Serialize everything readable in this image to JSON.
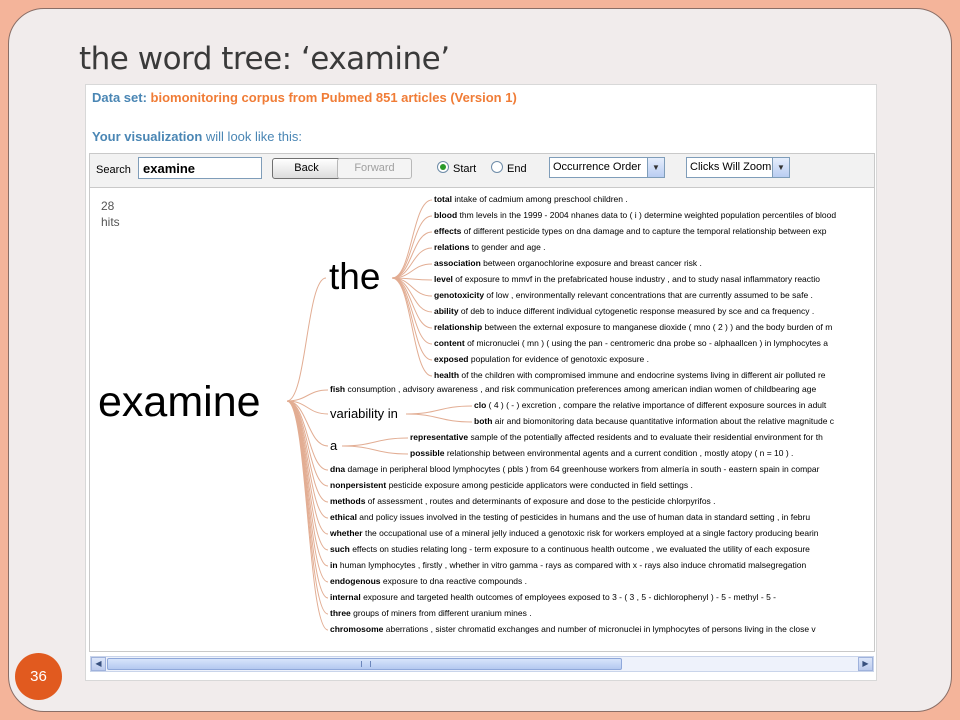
{
  "slide": {
    "title": "the word tree: ‘examine’",
    "page_number": "36"
  },
  "dataset": {
    "label": "Data set:",
    "value": "biomonitoring corpus from Pubmed 851 articles (Version 1)"
  },
  "visualization": {
    "bold": "Your visualization",
    "rest": " will look like this:"
  },
  "toolbar": {
    "search_label": "Search",
    "search_value": "examine",
    "back_label": "Back",
    "forward_label": "Forward",
    "start_label": "Start",
    "end_label": "End",
    "order_value": "Occurrence Order",
    "zoom_value": "Clicks Will Zoom"
  },
  "tree": {
    "hits_count": "28",
    "hits_label": "hits",
    "root": "examine",
    "the_node": "the",
    "variability_node": "variability in",
    "a_node": "a",
    "the_children": [
      {
        "w": "total",
        "t": " intake of cadmium among preschool children ."
      },
      {
        "w": "blood",
        "t": " thm levels in the 1999 - 2004 nhanes data to ( i ) determine weighted population percentiles of blood"
      },
      {
        "w": "effects",
        "t": " of different pesticide types on dna damage and to capture the temporal relationship between exp"
      },
      {
        "w": "relations",
        "t": " to gender and age ."
      },
      {
        "w": "association",
        "t": " between organochlorine exposure and breast cancer risk ."
      },
      {
        "w": "level",
        "t": " of exposure to mmvf in the prefabricated house industry , and to study nasal inflammatory reactio"
      },
      {
        "w": "genotoxicity",
        "t": " of low , environmentally relevant concentrations that are currently assumed to be safe ."
      },
      {
        "w": "ability",
        "t": " of deb to induce different individual cytogenetic response measured by sce and ca frequency ."
      },
      {
        "w": "relationship",
        "t": " between the external exposure to manganese dioxide ( mno ( 2 ) ) and the body burden of m"
      },
      {
        "w": "content",
        "t": " of micronuclei ( mn ) ( using the pan - centromeric dna probe so - alphaallcen ) in lymphocytes a"
      },
      {
        "w": "exposed",
        "t": " population for evidence of genotoxic exposure ."
      },
      {
        "w": "health",
        "t": " of the children with compromised immune and endocrine systems living in different air polluted re"
      }
    ],
    "fish": {
      "w": "fish",
      "t": " consumption , advisory awareness , and risk communication preferences among american indian women of childbearing age"
    },
    "variability_children": [
      {
        "w": "clo",
        "t": " ( 4 ) ( - ) excretion , compare the relative importance of different exposure sources in adult"
      },
      {
        "w": "both",
        "t": " air and biomonitoring data because quantitative information about the relative magnitude c"
      }
    ],
    "a_children": [
      {
        "w": "representative",
        "t": " sample of the potentially affected residents and to evaluate their residential environment for th"
      },
      {
        "w": "possible",
        "t": " relationship between environmental agents and a current condition , mostly atopy ( n = 10 ) ."
      }
    ],
    "bottom_children": [
      {
        "w": "dna",
        "t": " damage in peripheral blood lymphocytes ( pbls ) from 64 greenhouse workers from almería in south - eastern spain in compar"
      },
      {
        "w": "nonpersistent",
        "t": " pesticide exposure among pesticide applicators were conducted in field settings ."
      },
      {
        "w": "methods",
        "t": " of assessment , routes and determinants of exposure and dose to the pesticide chlorpyrifos ."
      },
      {
        "w": "ethical",
        "t": " and policy issues involved in the testing of pesticides in humans and the use of human data in standard setting , in febru"
      },
      {
        "w": "whether",
        "t": " the occupational use of a mineral jelly induced a genotoxic risk for workers employed at a single factory producing bearin"
      },
      {
        "w": "such",
        "t": " effects on studies relating long - term exposure to a continuous health outcome , we evaluated the utility of each exposure"
      },
      {
        "w": "in",
        "t": " human lymphocytes , firstly , whether in vitro gamma - rays as compared with x - rays also induce chromatid malsegregation"
      },
      {
        "w": "endogenous",
        "t": " exposure to dna reactive compounds ."
      },
      {
        "w": "internal",
        "t": " exposure and targeted health outcomes of employees exposed to 3 - ( 3 , 5 - dichlorophenyl ) - 5 - methyl - 5 -"
      },
      {
        "w": "three",
        "t": " groups of miners from different uranium mines ."
      },
      {
        "w": "chromosome",
        "t": " aberrations , sister chromatid exchanges and number of micronuclei in lymphocytes of persons living in the close v"
      }
    ]
  }
}
